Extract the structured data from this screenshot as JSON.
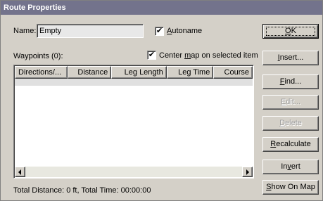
{
  "window": {
    "title": "Route Properties"
  },
  "name": {
    "label": "Name:",
    "value": "Empty"
  },
  "autoname": {
    "checked": true,
    "check_mark": "✔",
    "label_key": "A",
    "label_rest": "utoname"
  },
  "waypoints": {
    "label": "Waypoints (0):"
  },
  "center_map": {
    "checked": true,
    "check_mark": "✔",
    "label_pre": "Center ",
    "label_key": "m",
    "label_rest": "ap on selected item"
  },
  "columns": [
    "Directions/...",
    "Distance",
    "Leg Length",
    "Leg Time",
    "Course"
  ],
  "buttons": {
    "ok": {
      "pre": "",
      "key": "O",
      "rest": "K"
    },
    "insert": {
      "pre": "",
      "key": "I",
      "rest": "nsert..."
    },
    "find": {
      "pre": "",
      "key": "F",
      "rest": "ind..."
    },
    "edit": {
      "pre": "",
      "key": "E",
      "rest": "dit..."
    },
    "delete": {
      "pre": "",
      "key": "D",
      "rest": "elete"
    },
    "recalculate": {
      "pre": "",
      "key": "R",
      "rest": "ecalculate"
    },
    "invert": {
      "pre": "In",
      "key": "v",
      "rest": "ert"
    },
    "show_on_map": {
      "pre": "",
      "key": "S",
      "rest": "how On Map"
    }
  },
  "status": {
    "text": "Total Distance: 0 ft, Total Time: 00:00:00"
  },
  "colors": {
    "titlebar": "#73738c",
    "face": "#d4d0c8"
  }
}
